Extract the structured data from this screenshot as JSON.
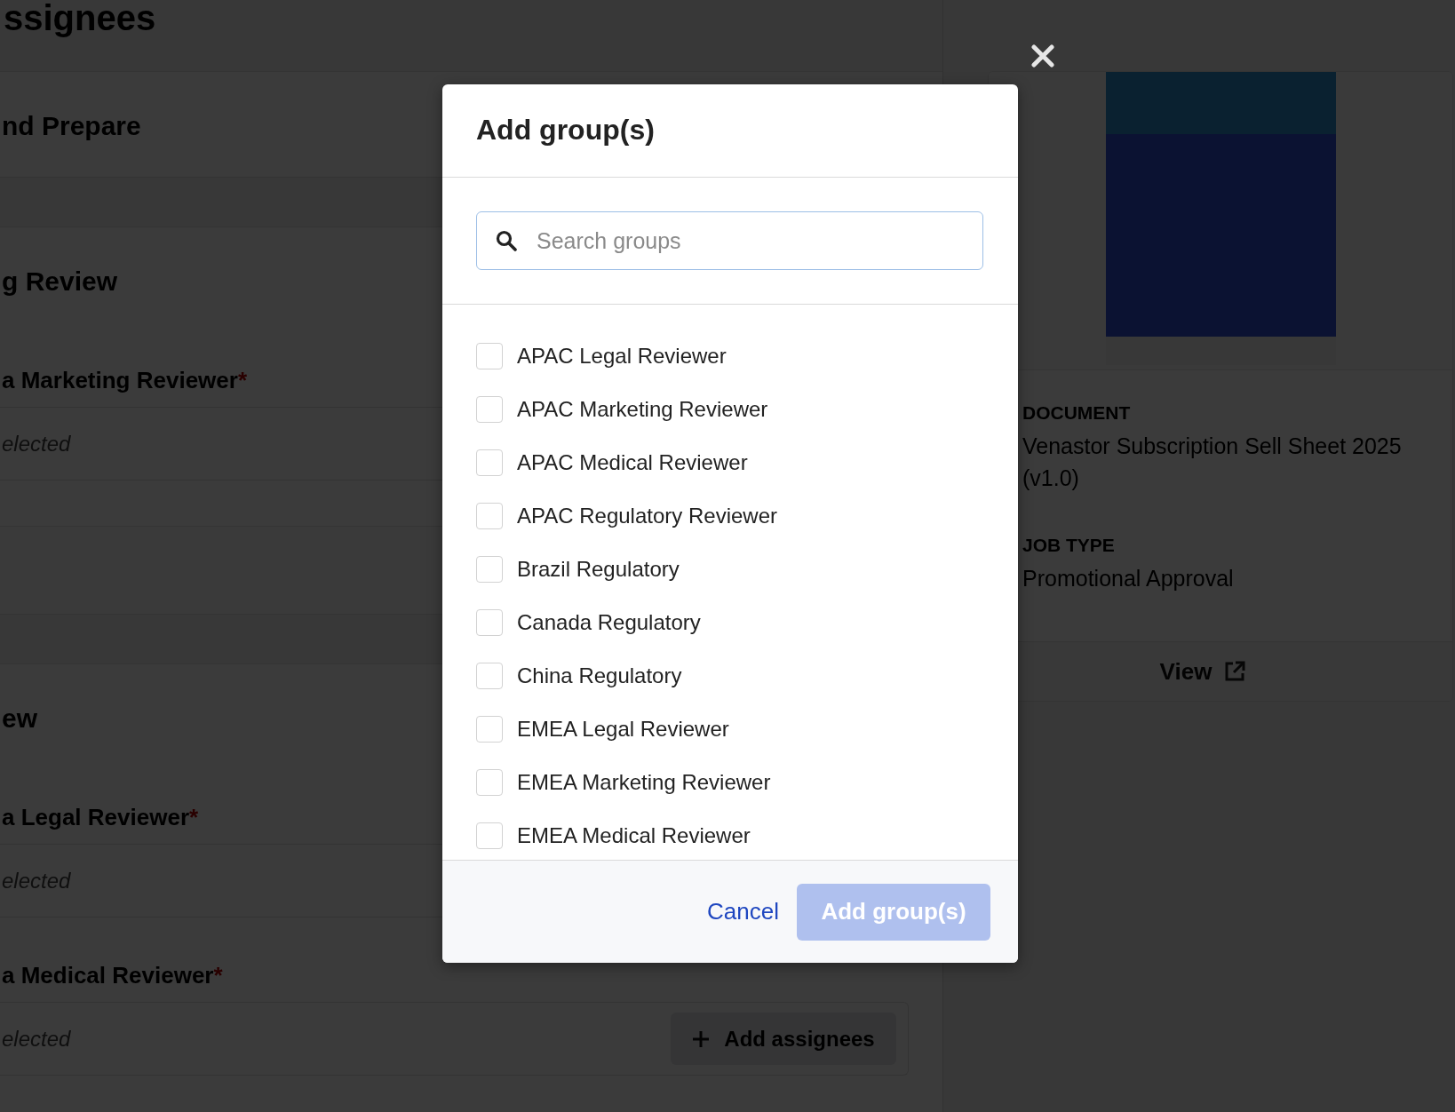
{
  "background_page": {
    "heading": "ssignees",
    "sections": [
      {
        "title": "nd Prepare"
      },
      {
        "title": "g Review",
        "roles": [
          {
            "label": "a Marketing Reviewer",
            "required_mark": "*",
            "empty_text": "elected"
          }
        ]
      },
      {
        "title": "ew",
        "roles": [
          {
            "label": "a Legal Reviewer",
            "required_mark": "*",
            "empty_text": "elected"
          },
          {
            "label": "a Medical Reviewer",
            "required_mark": "*",
            "empty_text": "elected",
            "action": "Add assignees"
          }
        ]
      }
    ]
  },
  "preview": {
    "fields": [
      {
        "label": "DOCUMENT",
        "value": "Venastor Subscription Sell Sheet 2025 (v1.0)"
      },
      {
        "label": "JOB TYPE",
        "value": "Promotional Approval"
      }
    ],
    "view_button": "View"
  },
  "dialog": {
    "title": "Add group(s)",
    "search": {
      "placeholder": "Search groups"
    },
    "groups": [
      {
        "label": "APAC Legal Reviewer",
        "checked": false
      },
      {
        "label": "APAC Marketing Reviewer",
        "checked": false
      },
      {
        "label": "APAC Medical Reviewer",
        "checked": false
      },
      {
        "label": "APAC Regulatory Reviewer",
        "checked": false
      },
      {
        "label": "Brazil Regulatory",
        "checked": false
      },
      {
        "label": "Canada Regulatory",
        "checked": false
      },
      {
        "label": "China Regulatory",
        "checked": false
      },
      {
        "label": "EMEA Legal Reviewer",
        "checked": false
      },
      {
        "label": "EMEA Marketing Reviewer",
        "checked": false
      },
      {
        "label": "EMEA Medical Reviewer",
        "checked": false
      }
    ],
    "cancel": "Cancel",
    "submit": {
      "label": "Add group(s)",
      "disabled": true
    }
  }
}
